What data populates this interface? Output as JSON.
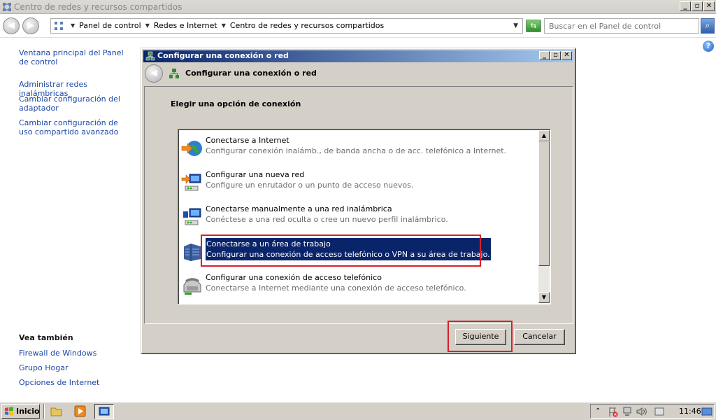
{
  "window": {
    "title": "Centro de redes y recursos compartidos",
    "buttons": {
      "minimize": "_",
      "maximize": "▫",
      "close": "✕"
    }
  },
  "address_bar": {
    "breadcrumbs": [
      "Panel de control",
      "Redes e Internet",
      "Centro de redes y recursos compartidos"
    ],
    "search_placeholder": "Buscar en el Panel de control"
  },
  "left_pane": {
    "links": [
      "Ventana principal del Panel de control",
      "Administrar redes inalámbricas",
      "Cambiar configuración del adaptador",
      "Cambiar configuración de uso compartido avanzado"
    ],
    "see_also_heading": "Vea también",
    "see_also": [
      "Firewall de Windows",
      "Grupo Hogar",
      "Opciones de Internet"
    ]
  },
  "dialog": {
    "title": "Configurar una conexión o red",
    "header": "Configurar una conexión o red",
    "subtitle": "Elegir una opción de conexión",
    "options": [
      {
        "title": "Conectarse a Internet",
        "desc": "Configurar conexión inalámb., de banda ancha o de acc. telefónico a Internet."
      },
      {
        "title": "Configurar una nueva red",
        "desc": "Configure un enrutador o un punto de acceso nuevos."
      },
      {
        "title": "Conectarse manualmente a una red inalámbrica",
        "desc": "Conéctese a una red oculta o cree un nuevo perfil inalámbrico."
      },
      {
        "title": "Conectarse a un área de trabajo",
        "desc": "Configurar una conexión de acceso telefónico o VPN a su área de trabajo."
      },
      {
        "title": "Configurar una conexión de acceso telefónico",
        "desc": "Conectarse a Internet mediante una conexión de acceso telefónico."
      }
    ],
    "selected_index": 3,
    "next_label": "Siguiente",
    "cancel_label": "Cancelar"
  },
  "taskbar": {
    "start_label": "Inicio",
    "clock": "11:46"
  },
  "colors": {
    "link": "#1a46a8",
    "selection": "#0a246a",
    "highlight_box": "#d9202a",
    "dialog_face": "#d4d0c8"
  }
}
